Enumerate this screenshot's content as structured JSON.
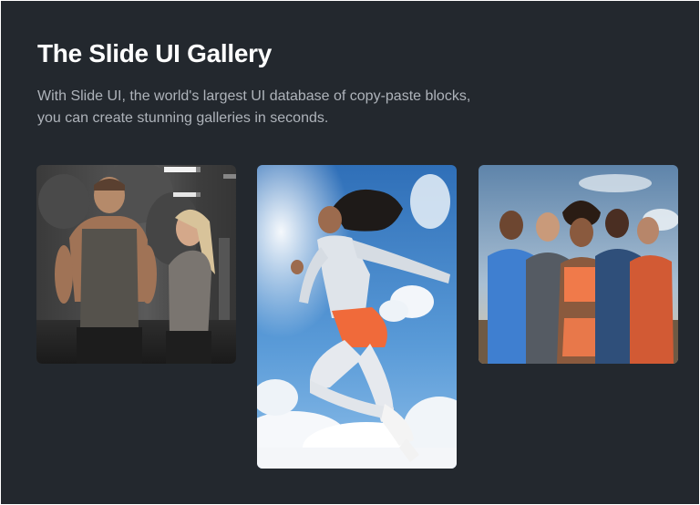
{
  "gallery": {
    "title": "The Slide UI Gallery",
    "description_lines": [
      "With Slide UI, the world's largest UI database of copy-paste blocks,",
      "you can create stunning galleries in seconds."
    ]
  },
  "images": [
    {
      "subject": "gym-couple",
      "palette": [
        "#2b2b2b",
        "#6b5a4a",
        "#c8b48a"
      ]
    },
    {
      "subject": "jumping-runner",
      "palette": [
        "#3f7fc4",
        "#f2f4f7",
        "#f06a3a"
      ]
    },
    {
      "subject": "athlete-team",
      "palette": [
        "#6d8fb0",
        "#e07a4a",
        "#3a3f4a"
      ]
    }
  ],
  "colors": {
    "background": "#23282e",
    "title": "#ffffff",
    "description": "#aeb3ba"
  }
}
